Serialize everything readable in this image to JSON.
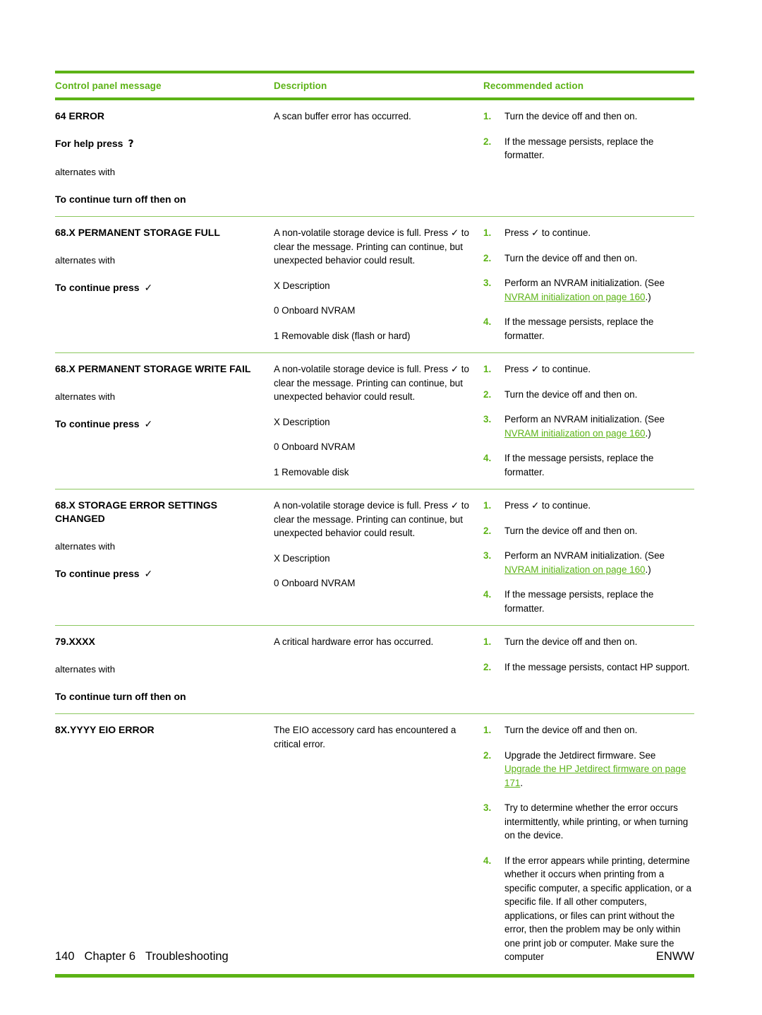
{
  "table": {
    "headers": {
      "col1": "Control panel message",
      "col2": "Description",
      "col3": "Recommended action"
    },
    "rows": [
      {
        "message": {
          "title": "64 ERROR",
          "second_line": "For help press",
          "second_line_glyph": "?",
          "alternates": "alternates with",
          "continue": "To continue turn off then on",
          "continue_glyph": ""
        },
        "description": [
          "A scan buffer error has occurred."
        ],
        "actions": [
          {
            "num": "1.",
            "text": "Turn the device off and then on."
          },
          {
            "num": "2.",
            "text": "If the message persists, replace the formatter."
          }
        ]
      },
      {
        "message": {
          "title": "68.X PERMANENT STORAGE FULL",
          "alternates": "alternates with",
          "continue": "To continue press",
          "continue_glyph": "✓"
        },
        "description": [
          "A non-volatile storage device is full. Press ✓ to clear the message. Printing can continue, but unexpected behavior could result.",
          "X Description",
          "0 Onboard NVRAM",
          "1 Removable disk (flash or hard)"
        ],
        "actions": [
          {
            "num": "1.",
            "text": "Press ✓ to continue."
          },
          {
            "num": "2.",
            "text": "Turn the device off and then on."
          },
          {
            "num": "3.",
            "text": "Perform an NVRAM initialization. (See ",
            "link": "NVRAM initialization on page 160",
            "text_after": ".)"
          },
          {
            "num": "4.",
            "text": "If the message persists, replace the formatter."
          }
        ]
      },
      {
        "message": {
          "title": "68.X PERMANENT STORAGE WRITE FAIL",
          "alternates": "alternates with",
          "continue": "To continue press",
          "continue_glyph": "✓"
        },
        "description": [
          "A non-volatile storage device is full. Press ✓ to clear the message. Printing can continue, but unexpected behavior could result.",
          "X Description",
          "0 Onboard NVRAM",
          "1 Removable disk"
        ],
        "actions": [
          {
            "num": "1.",
            "text": "Press ✓ to continue."
          },
          {
            "num": "2.",
            "text": "Turn the device off and then on."
          },
          {
            "num": "3.",
            "text": "Perform an NVRAM initialization. (See ",
            "link": "NVRAM initialization on page 160",
            "text_after": ".)"
          },
          {
            "num": "4.",
            "text": "If the message persists, replace the formatter."
          }
        ]
      },
      {
        "message": {
          "title": "68.X STORAGE ERROR SETTINGS CHANGED",
          "alternates": "alternates with",
          "continue": "To continue press",
          "continue_glyph": "✓"
        },
        "description": [
          "A non-volatile storage device is full. Press ✓ to clear the message. Printing can continue, but unexpected behavior could result.",
          "X Description",
          "0 Onboard NVRAM"
        ],
        "actions": [
          {
            "num": "1.",
            "text": "Press ✓ to continue."
          },
          {
            "num": "2.",
            "text": "Turn the device off and then on."
          },
          {
            "num": "3.",
            "text": "Perform an NVRAM initialization. (See ",
            "link": "NVRAM initialization on page 160",
            "text_after": ".)"
          },
          {
            "num": "4.",
            "text": "If the message persists, replace the formatter."
          }
        ]
      },
      {
        "message": {
          "title": "79.XXXX",
          "alternates": "alternates with",
          "continue": "To continue turn off then on",
          "continue_glyph": ""
        },
        "description": [
          "A critical hardware error has occurred."
        ],
        "actions": [
          {
            "num": "1.",
            "text": "Turn the device off and then on."
          },
          {
            "num": "2.",
            "text": "If the message persists, contact HP support."
          }
        ]
      },
      {
        "message": {
          "title": "8X.YYYY EIO ERROR",
          "alternates": "",
          "continue": "",
          "continue_glyph": ""
        },
        "description": [
          "The EIO accessory card has encountered a critical error."
        ],
        "actions": [
          {
            "num": "1.",
            "text": "Turn the device off and then on."
          },
          {
            "num": "2.",
            "text": "Upgrade the Jetdirect firmware. See ",
            "link": "Upgrade the HP Jetdirect firmware on page 171",
            "text_after": "."
          },
          {
            "num": "3.",
            "text": "Try to determine whether the error occurs intermittently, while printing, or when turning on the device."
          },
          {
            "num": "4.",
            "text": "If the error appears while printing, determine whether it occurs when printing from a specific computer, a specific application, or a specific file. If all other computers, applications, or files can print without the error, then the problem may be only within one print job or computer. Make sure the computer"
          }
        ]
      }
    ]
  },
  "footer": {
    "page_number": "140",
    "chapter": "Chapter 6",
    "chapter_title": "Troubleshooting",
    "locale": "ENWW"
  },
  "colors": {
    "accent_green": "#5CB316",
    "rule_light_green": "#8CC85F",
    "body_text": "#000000"
  }
}
